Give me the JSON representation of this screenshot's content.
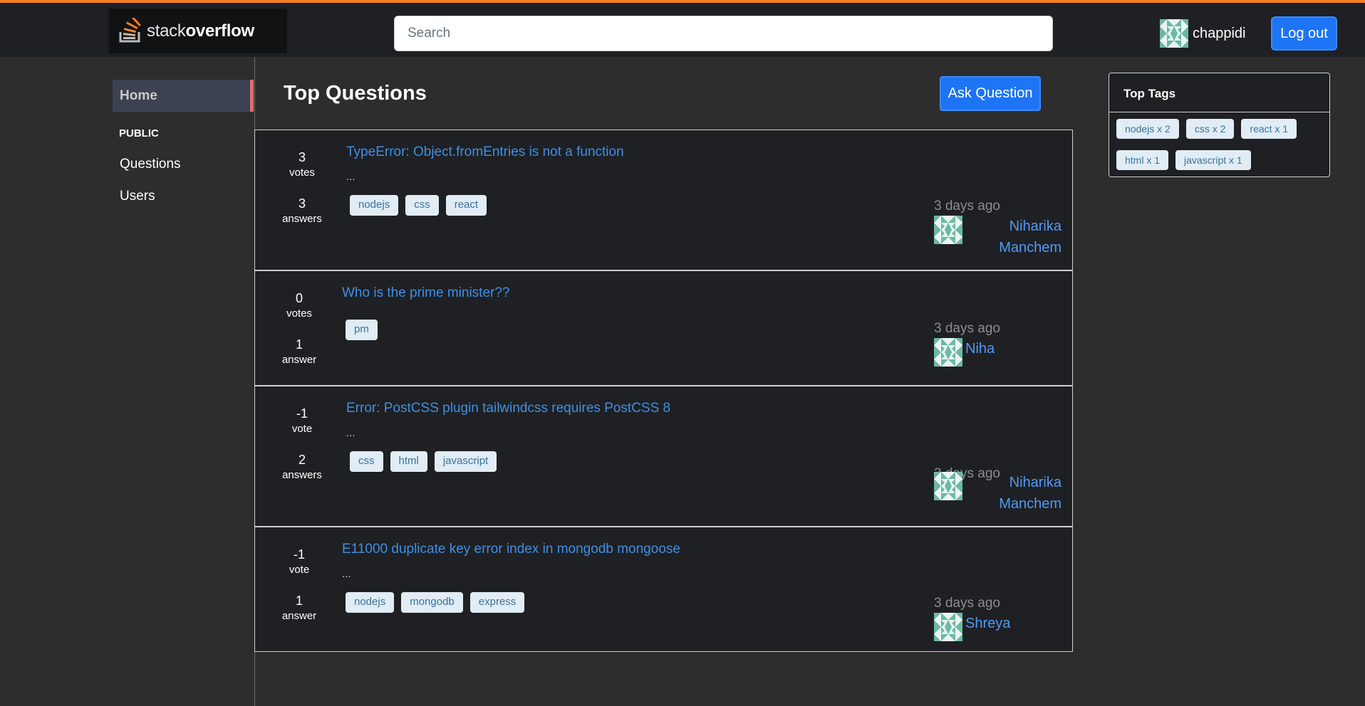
{
  "header": {
    "logo_text_light": "stack",
    "logo_text_bold": "overflow",
    "search_placeholder": "Search",
    "username": "chappidi",
    "logout_label": "Log out"
  },
  "sidebar": {
    "home_label": "Home",
    "section_label": "PUBLIC",
    "items": [
      {
        "label": "Questions"
      },
      {
        "label": "Users"
      }
    ]
  },
  "main": {
    "title": "Top Questions",
    "ask_label": "Ask Question",
    "questions": [
      {
        "votes": "3",
        "votes_label": "votes",
        "answers": "3",
        "answers_label": "answers",
        "title": "TypeError: Object.fromEntries is not a function",
        "excerpt": "...",
        "tags": [
          "nodejs",
          "css",
          "react"
        ],
        "time": "3 days ago",
        "author_line1": "Niharika",
        "author_line2": "Manchem"
      },
      {
        "votes": "0",
        "votes_label": "votes",
        "answers": "1",
        "answers_label": "answer",
        "title": "Who is the prime minister??",
        "excerpt": "",
        "tags": [
          "pm"
        ],
        "time": "3 days ago",
        "author_line1": "Niha",
        "author_line2": ""
      },
      {
        "votes": "-1",
        "votes_label": "vote",
        "answers": "2",
        "answers_label": "answers",
        "title": "Error: PostCSS plugin tailwindcss requires PostCSS 8",
        "excerpt": "...",
        "tags": [
          "css",
          "html",
          "javascript"
        ],
        "time": "3 days ago",
        "author_line1": "Niharika",
        "author_line2": "Manchem"
      },
      {
        "votes": "-1",
        "votes_label": "vote",
        "answers": "1",
        "answers_label": "answer",
        "title": "E11000 duplicate key error index in mongodb mongoose",
        "excerpt": "...",
        "tags": [
          "nodejs",
          "mongodb",
          "express"
        ],
        "time": "3 days ago",
        "author_line1": "Shreya",
        "author_line2": ""
      }
    ]
  },
  "top_tags": {
    "title": "Top Tags",
    "tags": [
      "nodejs x 2",
      "css x 2",
      "react x 1",
      "html x 1",
      "javascript x 1"
    ]
  },
  "colors": {
    "accent": "#f48024",
    "primary_button": "#1d74f5",
    "link": "#3f8fe6",
    "tag_bg": "#e1ecf4"
  },
  "icons": {
    "logo": "stackoverflow-logo-icon",
    "avatar": "identicon-avatar-icon"
  }
}
